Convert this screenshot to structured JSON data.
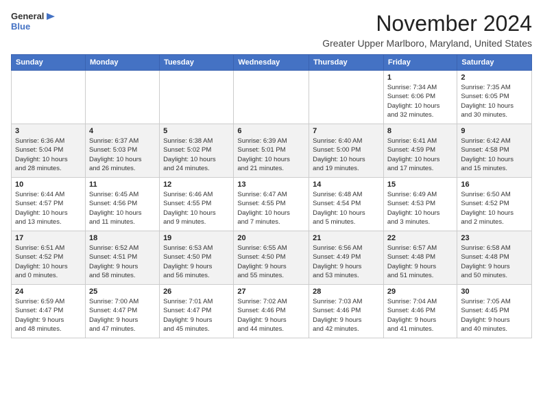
{
  "header": {
    "logo_line1": "General",
    "logo_line2": "Blue",
    "month": "November 2024",
    "location": "Greater Upper Marlboro, Maryland, United States"
  },
  "weekdays": [
    "Sunday",
    "Monday",
    "Tuesday",
    "Wednesday",
    "Thursday",
    "Friday",
    "Saturday"
  ],
  "weeks": [
    [
      {
        "day": "",
        "info": ""
      },
      {
        "day": "",
        "info": ""
      },
      {
        "day": "",
        "info": ""
      },
      {
        "day": "",
        "info": ""
      },
      {
        "day": "",
        "info": ""
      },
      {
        "day": "1",
        "info": "Sunrise: 7:34 AM\nSunset: 6:06 PM\nDaylight: 10 hours\nand 32 minutes."
      },
      {
        "day": "2",
        "info": "Sunrise: 7:35 AM\nSunset: 6:05 PM\nDaylight: 10 hours\nand 30 minutes."
      }
    ],
    [
      {
        "day": "3",
        "info": "Sunrise: 6:36 AM\nSunset: 5:04 PM\nDaylight: 10 hours\nand 28 minutes."
      },
      {
        "day": "4",
        "info": "Sunrise: 6:37 AM\nSunset: 5:03 PM\nDaylight: 10 hours\nand 26 minutes."
      },
      {
        "day": "5",
        "info": "Sunrise: 6:38 AM\nSunset: 5:02 PM\nDaylight: 10 hours\nand 24 minutes."
      },
      {
        "day": "6",
        "info": "Sunrise: 6:39 AM\nSunset: 5:01 PM\nDaylight: 10 hours\nand 21 minutes."
      },
      {
        "day": "7",
        "info": "Sunrise: 6:40 AM\nSunset: 5:00 PM\nDaylight: 10 hours\nand 19 minutes."
      },
      {
        "day": "8",
        "info": "Sunrise: 6:41 AM\nSunset: 4:59 PM\nDaylight: 10 hours\nand 17 minutes."
      },
      {
        "day": "9",
        "info": "Sunrise: 6:42 AM\nSunset: 4:58 PM\nDaylight: 10 hours\nand 15 minutes."
      }
    ],
    [
      {
        "day": "10",
        "info": "Sunrise: 6:44 AM\nSunset: 4:57 PM\nDaylight: 10 hours\nand 13 minutes."
      },
      {
        "day": "11",
        "info": "Sunrise: 6:45 AM\nSunset: 4:56 PM\nDaylight: 10 hours\nand 11 minutes."
      },
      {
        "day": "12",
        "info": "Sunrise: 6:46 AM\nSunset: 4:55 PM\nDaylight: 10 hours\nand 9 minutes."
      },
      {
        "day": "13",
        "info": "Sunrise: 6:47 AM\nSunset: 4:55 PM\nDaylight: 10 hours\nand 7 minutes."
      },
      {
        "day": "14",
        "info": "Sunrise: 6:48 AM\nSunset: 4:54 PM\nDaylight: 10 hours\nand 5 minutes."
      },
      {
        "day": "15",
        "info": "Sunrise: 6:49 AM\nSunset: 4:53 PM\nDaylight: 10 hours\nand 3 minutes."
      },
      {
        "day": "16",
        "info": "Sunrise: 6:50 AM\nSunset: 4:52 PM\nDaylight: 10 hours\nand 2 minutes."
      }
    ],
    [
      {
        "day": "17",
        "info": "Sunrise: 6:51 AM\nSunset: 4:52 PM\nDaylight: 10 hours\nand 0 minutes."
      },
      {
        "day": "18",
        "info": "Sunrise: 6:52 AM\nSunset: 4:51 PM\nDaylight: 9 hours\nand 58 minutes."
      },
      {
        "day": "19",
        "info": "Sunrise: 6:53 AM\nSunset: 4:50 PM\nDaylight: 9 hours\nand 56 minutes."
      },
      {
        "day": "20",
        "info": "Sunrise: 6:55 AM\nSunset: 4:50 PM\nDaylight: 9 hours\nand 55 minutes."
      },
      {
        "day": "21",
        "info": "Sunrise: 6:56 AM\nSunset: 4:49 PM\nDaylight: 9 hours\nand 53 minutes."
      },
      {
        "day": "22",
        "info": "Sunrise: 6:57 AM\nSunset: 4:48 PM\nDaylight: 9 hours\nand 51 minutes."
      },
      {
        "day": "23",
        "info": "Sunrise: 6:58 AM\nSunset: 4:48 PM\nDaylight: 9 hours\nand 50 minutes."
      }
    ],
    [
      {
        "day": "24",
        "info": "Sunrise: 6:59 AM\nSunset: 4:47 PM\nDaylight: 9 hours\nand 48 minutes."
      },
      {
        "day": "25",
        "info": "Sunrise: 7:00 AM\nSunset: 4:47 PM\nDaylight: 9 hours\nand 47 minutes."
      },
      {
        "day": "26",
        "info": "Sunrise: 7:01 AM\nSunset: 4:47 PM\nDaylight: 9 hours\nand 45 minutes."
      },
      {
        "day": "27",
        "info": "Sunrise: 7:02 AM\nSunset: 4:46 PM\nDaylight: 9 hours\nand 44 minutes."
      },
      {
        "day": "28",
        "info": "Sunrise: 7:03 AM\nSunset: 4:46 PM\nDaylight: 9 hours\nand 42 minutes."
      },
      {
        "day": "29",
        "info": "Sunrise: 7:04 AM\nSunset: 4:46 PM\nDaylight: 9 hours\nand 41 minutes."
      },
      {
        "day": "30",
        "info": "Sunrise: 7:05 AM\nSunset: 4:45 PM\nDaylight: 9 hours\nand 40 minutes."
      }
    ]
  ]
}
